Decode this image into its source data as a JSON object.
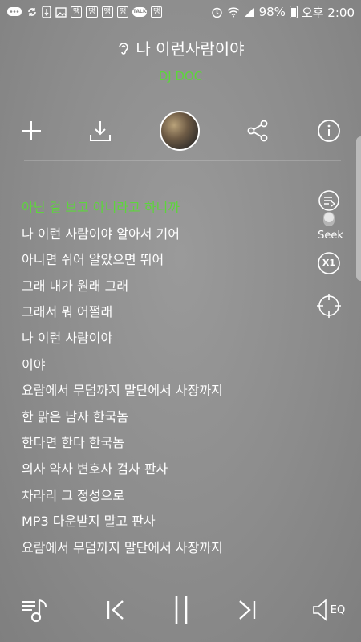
{
  "status_bar": {
    "left_icons": [
      "chat-icon",
      "sync-icon",
      "usb-icon",
      "image-icon",
      "app-badge-icon",
      "app-badge-icon",
      "app-badge-icon",
      "app-badge-icon",
      "talk-icon",
      "app-badge-icon"
    ],
    "badge_label": "땡",
    "talk_label": "TALK",
    "battery": "98%",
    "time": "오후 2:00"
  },
  "track": {
    "title": "나 이런사람이야",
    "artist": "DJ DOC"
  },
  "actions": [
    "add-icon",
    "download-icon",
    "album-cover",
    "share-icon",
    "info-icon"
  ],
  "lyrics": [
    "아닌 걸 보고 아니라고 하니까",
    "나 이런 사람이야 알아서 기어",
    "아니면 쉬어 알았으면 뛰어",
    "그래 내가 원래 그래",
    "그래서 뭐 어쩔래",
    "나 이런 사람이야",
    "이야",
    "요람에서 무덤까지 말단에서 사장까지",
    "한 맑은 남자 한국놈",
    "한다면 한다 한국놈",
    "의사 약사 변호사 검사 판사",
    "차라리 그 정성으로",
    "MP3 다운받지 말고 판사",
    "요람에서 무덤까지 말단에서 사장까지"
  ],
  "active_lyric_index": 0,
  "side": {
    "seek_label": "Seek",
    "speed_label": "X1"
  },
  "bottom": {
    "eq_label": "EQ"
  },
  "colors": {
    "accent": "#5ed53d",
    "background": "#8a8a8a"
  }
}
